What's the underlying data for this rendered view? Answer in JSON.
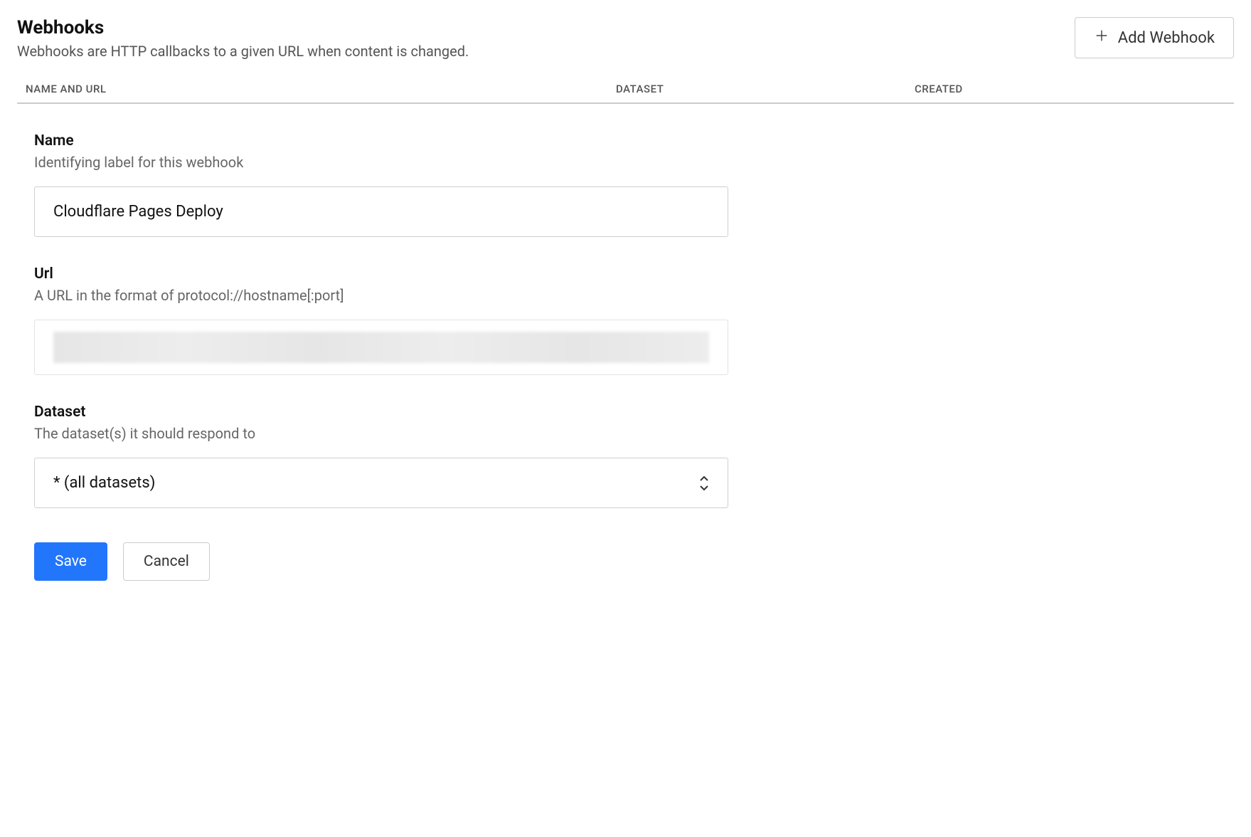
{
  "header": {
    "title": "Webhooks",
    "subtitle": "Webhooks are HTTP callbacks to a given URL when content is changed.",
    "add_button_label": "Add Webhook"
  },
  "table": {
    "columns": {
      "name_url": "NAME AND URL",
      "dataset": "DATASET",
      "created": "CREATED"
    }
  },
  "form": {
    "name": {
      "label": "Name",
      "help": "Identifying label for this webhook",
      "value": "Cloudflare Pages Deploy"
    },
    "url": {
      "label": "Url",
      "help": "A URL in the format of protocol://hostname[:port]",
      "value": ""
    },
    "dataset": {
      "label": "Dataset",
      "help": "The dataset(s) it should respond to",
      "value": "* (all datasets)"
    },
    "actions": {
      "save": "Save",
      "cancel": "Cancel"
    }
  }
}
